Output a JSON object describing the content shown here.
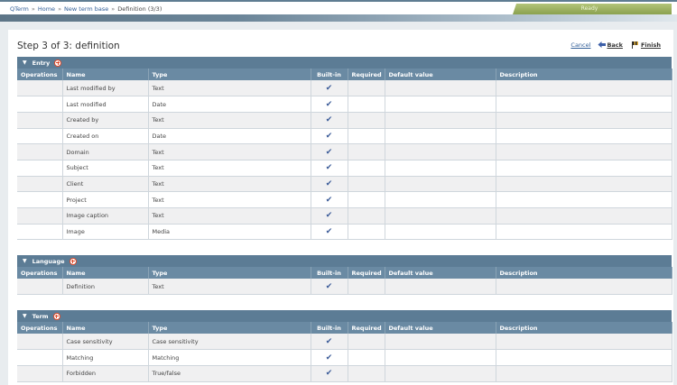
{
  "breadcrumb": {
    "items": [
      "QTerm",
      "Home",
      "New term base"
    ],
    "current": "Definition (3/3)",
    "separator": "»"
  },
  "status": "Ready",
  "page": {
    "title": "Step 3 of 3: definition",
    "cancel": "Cancel",
    "back": "Back",
    "finish": "Finish"
  },
  "columns": [
    "Operations",
    "Name",
    "Type",
    "Built-in",
    "Required",
    "Default value",
    "Description"
  ],
  "check_glyph": "✔",
  "sections": [
    {
      "title": "Entry",
      "rows": [
        {
          "name": "Last modified by",
          "type": "Text"
        },
        {
          "name": "Last modified",
          "type": "Date"
        },
        {
          "name": "Created by",
          "type": "Text"
        },
        {
          "name": "Created on",
          "type": "Date"
        },
        {
          "name": "Domain",
          "type": "Text"
        },
        {
          "name": "Subject",
          "type": "Text"
        },
        {
          "name": "Client",
          "type": "Text"
        },
        {
          "name": "Project",
          "type": "Text"
        },
        {
          "name": "Image caption",
          "type": "Text"
        },
        {
          "name": "Image",
          "type": "Media"
        }
      ]
    },
    {
      "title": "Language",
      "rows": [
        {
          "name": "Definition",
          "type": "Text"
        }
      ]
    },
    {
      "title": "Term",
      "rows": [
        {
          "name": "Case sensitivity",
          "type": "Case sensitivity"
        },
        {
          "name": "Matching",
          "type": "Matching"
        },
        {
          "name": "Forbidden",
          "type": "True/false"
        }
      ]
    }
  ],
  "colors": {
    "section_header": "#5c7c95",
    "column_header": "#6a8aa3",
    "link": "#2f5d97",
    "check": "#3b5b98",
    "status_tab": "#9cb35f"
  }
}
